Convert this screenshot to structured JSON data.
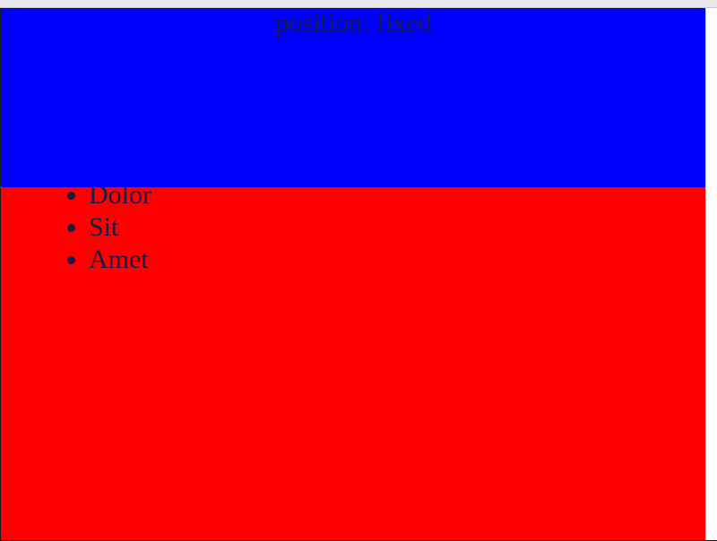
{
  "colors": {
    "page_background": "#ff0000",
    "header_background": "#0000ff",
    "text_color": "#1a1a4a"
  },
  "header": {
    "text": "position: fixed"
  },
  "list": {
    "items": [
      {
        "label": "Dolor"
      },
      {
        "label": "Sit"
      },
      {
        "label": "Amet"
      }
    ]
  }
}
